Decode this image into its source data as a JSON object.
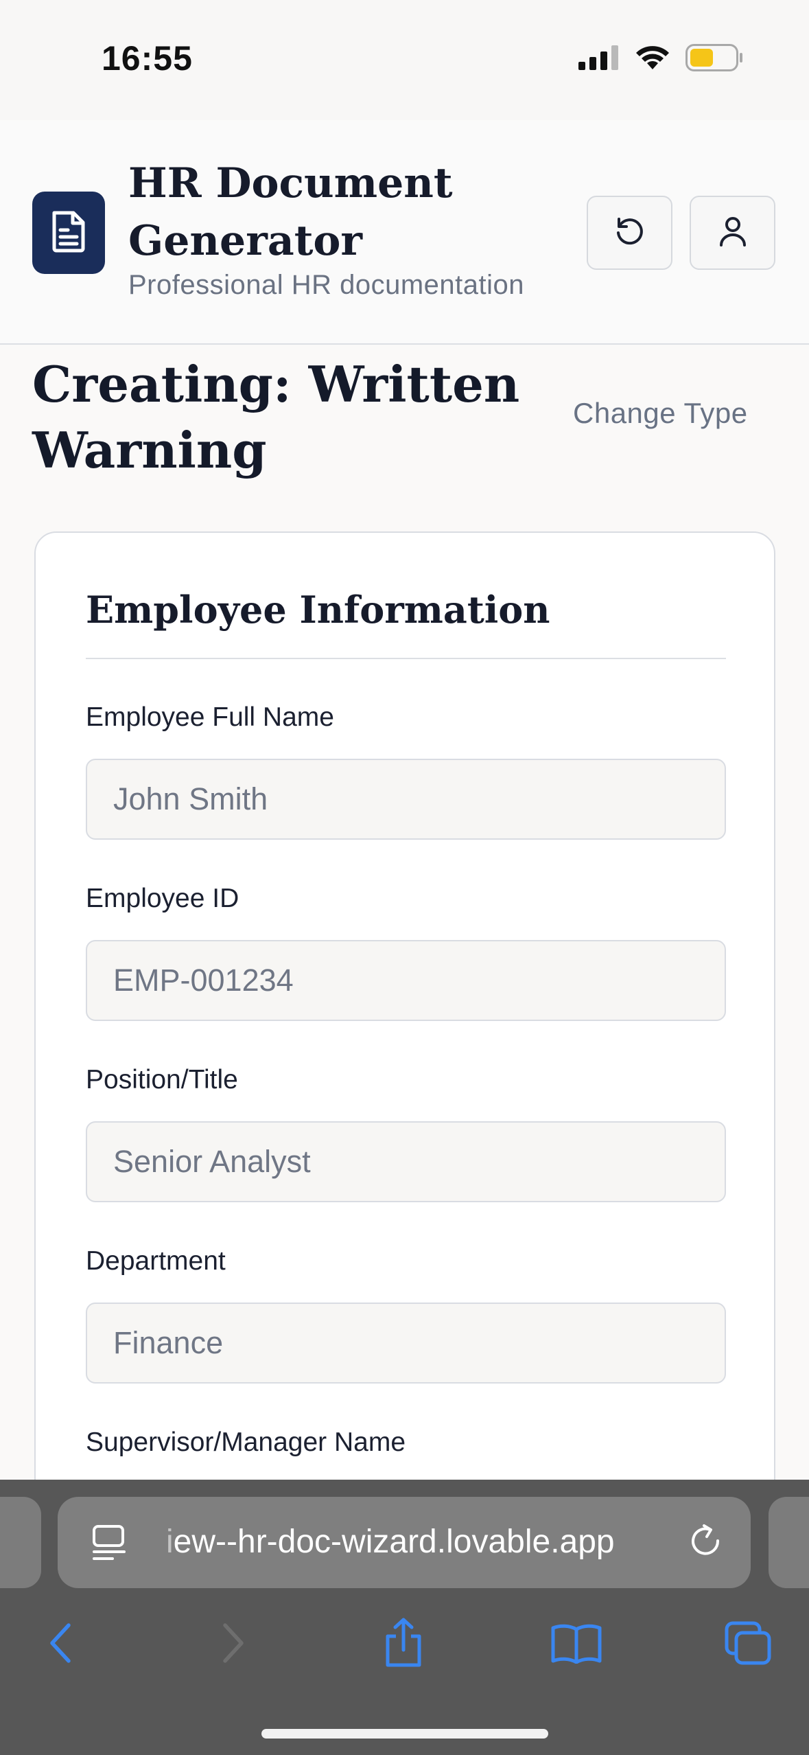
{
  "status_bar": {
    "time": "16:55",
    "icons": [
      "cellular-signal-icon",
      "wifi-icon",
      "battery-icon"
    ],
    "battery_color": "#f5c518"
  },
  "header": {
    "title": "HR Document Generator",
    "subtitle": "Professional HR documentation",
    "logo_icon": "document-icon",
    "buttons": [
      {
        "icon": "reset-icon"
      },
      {
        "icon": "user-icon"
      }
    ],
    "brand_color": "#1a2d5a"
  },
  "page": {
    "heading": "Creating: Written Warning",
    "change_type_label": "Change Type"
  },
  "form": {
    "section_title": "Employee Information",
    "fields": [
      {
        "label": "Employee Full Name",
        "placeholder": "John Smith",
        "value": ""
      },
      {
        "label": "Employee ID",
        "placeholder": "EMP-001234",
        "value": ""
      },
      {
        "label": "Position/Title",
        "placeholder": "Senior Analyst",
        "value": ""
      },
      {
        "label": "Department",
        "placeholder": "Finance",
        "value": ""
      },
      {
        "label": "Supervisor/Manager Name"
      }
    ]
  },
  "browser": {
    "url_faded_prefix": "i",
    "url_text": "ew--hr-doc-wizard.lovable.app",
    "toolbar_icons": [
      "back-icon",
      "forward-icon",
      "share-icon",
      "bookmarks-icon",
      "tabs-icon"
    ]
  }
}
